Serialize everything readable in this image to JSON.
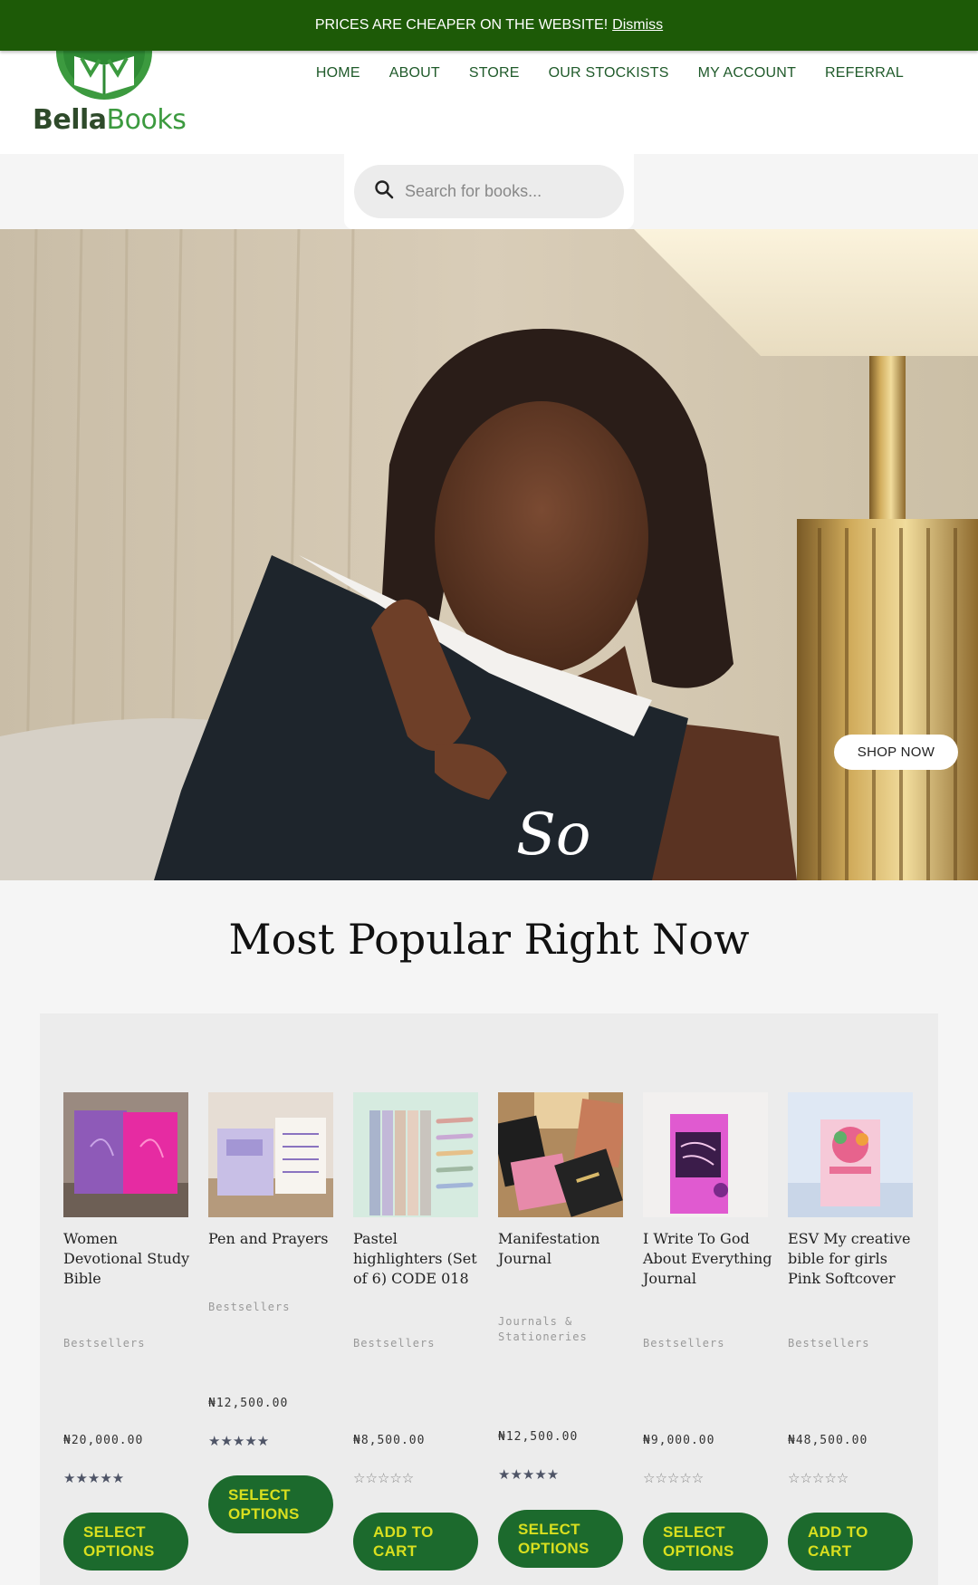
{
  "notice": {
    "text": "PRICES ARE CHEAPER ON THE WEBSITE!",
    "dismiss": "Dismiss"
  },
  "brand": {
    "part1": "Bella",
    "part2": "Books"
  },
  "nav": [
    "HOME",
    "ABOUT",
    "STORE",
    "OUR STOCKISTS",
    "MY ACCOUNT",
    "REFERRAL"
  ],
  "search": {
    "placeholder": "Search for books..."
  },
  "hero": {
    "cta": "SHOP NOW",
    "book_cover_text": "So"
  },
  "popular": {
    "title": "Most Popular Right Now"
  },
  "products": [
    {
      "name": "Women Devotional Study Bible",
      "category": "Bestsellers",
      "price": "₦20,000.00",
      "rating": 5,
      "button": "SELECT OPTIONS"
    },
    {
      "name": "Pen and Prayers",
      "category": "Bestsellers",
      "price": "₦12,500.00",
      "rating": 5,
      "button": "SELECT OPTIONS"
    },
    {
      "name": "Pastel highlighters (Set of 6) CODE 018",
      "category": "Bestsellers",
      "price": "₦8,500.00",
      "rating": 0,
      "button": "ADD TO CART"
    },
    {
      "name": "Manifestation Journal",
      "category": "Journals & Stationeries",
      "price": "₦12,500.00",
      "rating": 5,
      "button": "SELECT OPTIONS"
    },
    {
      "name": "I Write To God About Everything Journal",
      "category": "Bestsellers",
      "price": "₦9,000.00",
      "rating": 0,
      "button": "SELECT OPTIONS"
    },
    {
      "name": "ESV My creative bible for girls Pink Softcover",
      "category": "Bestsellers",
      "price": "₦48,500.00",
      "rating": 0,
      "button": "ADD TO CART"
    }
  ],
  "colors": {
    "brand_green": "#1d5a07",
    "button_green": "#1c6a2d",
    "button_text": "#d9df1f",
    "nav_text": "#1f5a2a"
  },
  "icons": {
    "search": "search-icon",
    "star": "star-icon"
  }
}
